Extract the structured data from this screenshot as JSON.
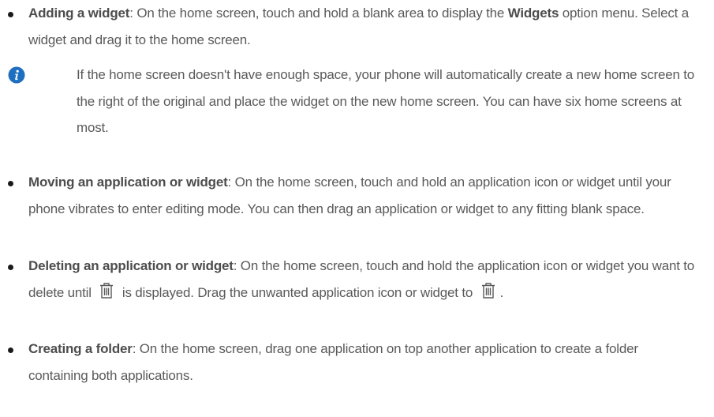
{
  "items": [
    {
      "title": "Adding a widget",
      "text_a": ": On the home screen, touch and hold a blank area to display the ",
      "strong2": "Widgets",
      "text_b": " option menu. Select a widget and drag it to the home screen."
    },
    {
      "title": "Moving an application or widget",
      "text_a": ": On the home screen, touch and hold an application icon or widget until your phone vibrates to enter editing mode. You can then drag an application or widget to any fitting blank space."
    },
    {
      "title": "Deleting an application or widget",
      "text_a": ": On the home screen, touch and hold the application icon or widget you want to delete until ",
      "text_b": " is displayed. Drag the unwanted application icon or widget to ",
      "text_c": "."
    },
    {
      "title": "Creating a folder",
      "text_a": ": On the home screen, drag one application on top another application to create a folder containing both applications."
    }
  ],
  "note": {
    "icon": "info-icon",
    "text": "If the home screen doesn't have enough space, your phone will automatically create a new home screen to the right of the original and place the widget on the new home screen. You can have six home screens at most."
  },
  "colors": {
    "body_text": "#5a5a5a",
    "bold_text": "#4d4d4d",
    "bullet": "#1a1a1a",
    "info_icon": "#1f6fc1"
  }
}
